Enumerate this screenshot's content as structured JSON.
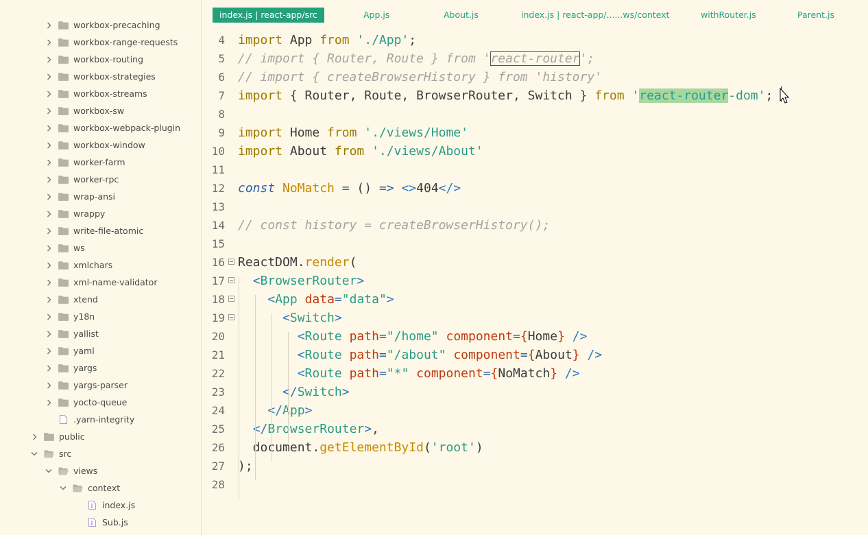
{
  "sidebar": {
    "items": [
      {
        "label": "workbox-precaching",
        "type": "folder",
        "expanded": false
      },
      {
        "label": "workbox-range-requests",
        "type": "folder",
        "expanded": false
      },
      {
        "label": "workbox-routing",
        "type": "folder",
        "expanded": false
      },
      {
        "label": "workbox-strategies",
        "type": "folder",
        "expanded": false
      },
      {
        "label": "workbox-streams",
        "type": "folder",
        "expanded": false
      },
      {
        "label": "workbox-sw",
        "type": "folder",
        "expanded": false
      },
      {
        "label": "workbox-webpack-plugin",
        "type": "folder",
        "expanded": false
      },
      {
        "label": "workbox-window",
        "type": "folder",
        "expanded": false
      },
      {
        "label": "worker-farm",
        "type": "folder",
        "expanded": false
      },
      {
        "label": "worker-rpc",
        "type": "folder",
        "expanded": false
      },
      {
        "label": "wrap-ansi",
        "type": "folder",
        "expanded": false
      },
      {
        "label": "wrappy",
        "type": "folder",
        "expanded": false
      },
      {
        "label": "write-file-atomic",
        "type": "folder",
        "expanded": false
      },
      {
        "label": "ws",
        "type": "folder",
        "expanded": false
      },
      {
        "label": "xmlchars",
        "type": "folder",
        "expanded": false
      },
      {
        "label": "xml-name-validator",
        "type": "folder",
        "expanded": false
      },
      {
        "label": "xtend",
        "type": "folder",
        "expanded": false
      },
      {
        "label": "y18n",
        "type": "folder",
        "expanded": false
      },
      {
        "label": "yallist",
        "type": "folder",
        "expanded": false
      },
      {
        "label": "yaml",
        "type": "folder",
        "expanded": false
      },
      {
        "label": "yargs",
        "type": "folder",
        "expanded": false
      },
      {
        "label": "yargs-parser",
        "type": "folder",
        "expanded": false
      },
      {
        "label": "yocto-queue",
        "type": "folder",
        "expanded": false
      },
      {
        "label": ".yarn-integrity",
        "type": "file",
        "expanded": false
      },
      {
        "label": "public",
        "type": "folder",
        "expanded": false
      },
      {
        "label": "src",
        "type": "folder",
        "expanded": true
      },
      {
        "label": "views",
        "type": "folder",
        "expanded": true
      },
      {
        "label": "context",
        "type": "folder",
        "expanded": true
      },
      {
        "label": "index.js",
        "type": "jsfile",
        "expanded": false
      },
      {
        "label": "Sub.js",
        "type": "jsfile",
        "expanded": false
      }
    ]
  },
  "tabs": [
    {
      "label": "index.js | react-app/src",
      "active": true
    },
    {
      "label": "App.js",
      "active": false
    },
    {
      "label": "About.js",
      "active": false
    },
    {
      "label": "index.js | react-app/......ws/context",
      "active": false
    },
    {
      "label": "withRouter.js",
      "active": false
    },
    {
      "label": "Parent.js",
      "active": false
    }
  ],
  "editor": {
    "lines": [
      {
        "num": "4",
        "tokens": [
          [
            "kw",
            "import"
          ],
          [
            "var",
            " App "
          ],
          [
            "kw",
            "from"
          ],
          [
            "var",
            " "
          ],
          [
            "str",
            "'./App'"
          ],
          [
            "var",
            ";"
          ]
        ]
      },
      {
        "num": "5",
        "tokens": [
          [
            "cmt",
            "// import { Router, Route } from '"
          ],
          [
            "cmt box",
            "react-router"
          ],
          [
            "cmt",
            "';"
          ]
        ]
      },
      {
        "num": "6",
        "tokens": [
          [
            "cmt",
            "// import { createBrowserHistory } from 'history'"
          ]
        ]
      },
      {
        "num": "7",
        "tokens": [
          [
            "kw",
            "import"
          ],
          [
            "var",
            " { Router, Route, BrowserRouter, Switch } "
          ],
          [
            "kw",
            "from"
          ],
          [
            "var",
            " "
          ],
          [
            "str",
            "'"
          ],
          [
            "str hl",
            "react-router"
          ],
          [
            "str",
            "-dom'"
          ],
          [
            "var",
            ";"
          ]
        ]
      },
      {
        "num": "8",
        "tokens": []
      },
      {
        "num": "9",
        "tokens": [
          [
            "kw",
            "import"
          ],
          [
            "var",
            " Home "
          ],
          [
            "kw",
            "from"
          ],
          [
            "var",
            " "
          ],
          [
            "str",
            "'./views/Home'"
          ]
        ]
      },
      {
        "num": "10",
        "tokens": [
          [
            "kw",
            "import"
          ],
          [
            "var",
            " About "
          ],
          [
            "kw",
            "from"
          ],
          [
            "var",
            " "
          ],
          [
            "str",
            "'./views/About'"
          ]
        ]
      },
      {
        "num": "11",
        "tokens": []
      },
      {
        "num": "12",
        "tokens": [
          [
            "const",
            "const"
          ],
          [
            "var",
            " "
          ],
          [
            "fn",
            "NoMatch"
          ],
          [
            "var",
            " "
          ],
          [
            "op",
            "="
          ],
          [
            "var",
            " () "
          ],
          [
            "op",
            "=>"
          ],
          [
            "var",
            " "
          ],
          [
            "tagp",
            "<>"
          ],
          [
            "var",
            "404"
          ],
          [
            "tagp",
            "</>"
          ]
        ]
      },
      {
        "num": "13",
        "tokens": []
      },
      {
        "num": "14",
        "tokens": [
          [
            "cmt",
            "// const history = createBrowserHistory();"
          ]
        ]
      },
      {
        "num": "15",
        "tokens": []
      },
      {
        "num": "16",
        "fold": true,
        "tokens": [
          [
            "var",
            "ReactDOM."
          ],
          [
            "fn",
            "render"
          ],
          [
            "var",
            "("
          ]
        ]
      },
      {
        "num": "17",
        "fold": true,
        "tokens": [
          [
            "var",
            "  "
          ],
          [
            "tagp",
            "<"
          ],
          [
            "tag",
            "BrowserRouter"
          ],
          [
            "tagp",
            ">"
          ]
        ]
      },
      {
        "num": "18",
        "fold": true,
        "tokens": [
          [
            "var",
            "    "
          ],
          [
            "tagp",
            "<"
          ],
          [
            "tag",
            "App"
          ],
          [
            "var",
            " "
          ],
          [
            "attr",
            "data"
          ],
          [
            "op",
            "="
          ],
          [
            "str",
            "\"data\""
          ],
          [
            "tagp",
            ">"
          ]
        ]
      },
      {
        "num": "19",
        "fold": true,
        "tokens": [
          [
            "var",
            "      "
          ],
          [
            "tagp",
            "<"
          ],
          [
            "tag",
            "Switch"
          ],
          [
            "tagp",
            ">"
          ]
        ]
      },
      {
        "num": "20",
        "tokens": [
          [
            "var",
            "        "
          ],
          [
            "tagp",
            "<"
          ],
          [
            "tag",
            "Route"
          ],
          [
            "var",
            " "
          ],
          [
            "attr",
            "path"
          ],
          [
            "op",
            "="
          ],
          [
            "str",
            "\"/home\""
          ],
          [
            "var",
            " "
          ],
          [
            "attr",
            "component"
          ],
          [
            "op",
            "="
          ],
          [
            "attr",
            "{"
          ],
          [
            "var",
            "Home"
          ],
          [
            "attr",
            "}"
          ],
          [
            "var",
            " "
          ],
          [
            "tagp",
            "/>"
          ]
        ]
      },
      {
        "num": "21",
        "tokens": [
          [
            "var",
            "        "
          ],
          [
            "tagp",
            "<"
          ],
          [
            "tag",
            "Route"
          ],
          [
            "var",
            " "
          ],
          [
            "attr",
            "path"
          ],
          [
            "op",
            "="
          ],
          [
            "str",
            "\"/about\""
          ],
          [
            "var",
            " "
          ],
          [
            "attr",
            "component"
          ],
          [
            "op",
            "="
          ],
          [
            "attr",
            "{"
          ],
          [
            "var",
            "About"
          ],
          [
            "attr",
            "}"
          ],
          [
            "var",
            " "
          ],
          [
            "tagp",
            "/>"
          ]
        ]
      },
      {
        "num": "22",
        "tokens": [
          [
            "var",
            "        "
          ],
          [
            "tagp",
            "<"
          ],
          [
            "tag",
            "Route"
          ],
          [
            "var",
            " "
          ],
          [
            "attr",
            "path"
          ],
          [
            "op",
            "="
          ],
          [
            "str",
            "\"*\""
          ],
          [
            "var",
            " "
          ],
          [
            "attr",
            "component"
          ],
          [
            "op",
            "="
          ],
          [
            "attr",
            "{"
          ],
          [
            "var",
            "NoMatch"
          ],
          [
            "attr",
            "}"
          ],
          [
            "var",
            " "
          ],
          [
            "tagp",
            "/>"
          ]
        ]
      },
      {
        "num": "23",
        "tokens": [
          [
            "var",
            "      "
          ],
          [
            "tagp",
            "</"
          ],
          [
            "tag",
            "Switch"
          ],
          [
            "tagp",
            ">"
          ]
        ]
      },
      {
        "num": "24",
        "tokens": [
          [
            "var",
            "    "
          ],
          [
            "tagp",
            "</"
          ],
          [
            "tag",
            "App"
          ],
          [
            "tagp",
            ">"
          ]
        ]
      },
      {
        "num": "25",
        "tokens": [
          [
            "var",
            "  "
          ],
          [
            "tagp",
            "</"
          ],
          [
            "tag",
            "BrowserRouter"
          ],
          [
            "tagp",
            ">"
          ],
          [
            "var",
            ","
          ]
        ]
      },
      {
        "num": "26",
        "tokens": [
          [
            "var",
            "  document."
          ],
          [
            "fn",
            "getElementById"
          ],
          [
            "var",
            "("
          ],
          [
            "str",
            "'root'"
          ],
          [
            "var",
            ")"
          ]
        ]
      },
      {
        "num": "27",
        "tokens": [
          [
            "var",
            ");"
          ]
        ]
      },
      {
        "num": "28",
        "tokens": []
      }
    ]
  },
  "colors": {
    "background": "#fdf8e7",
    "accent": "#26a07b",
    "tab_text": "#27a08a"
  }
}
